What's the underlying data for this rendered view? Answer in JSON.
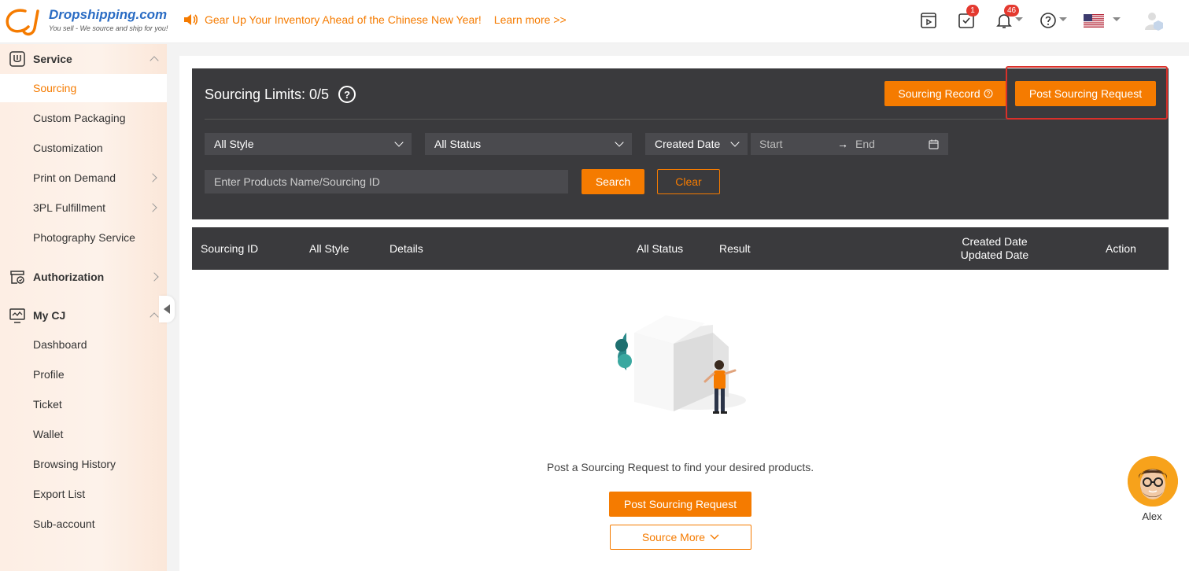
{
  "header": {
    "logo_name": "Dropshipping.com",
    "logo_tagline": "You sell - We source and ship for you!",
    "promo_text": "Gear Up Your Inventory Ahead of the Chinese New Year!",
    "promo_link": "Learn more >>",
    "tasks_badge": "1",
    "notifications_badge": "46",
    "help_icon": "help-circle-icon",
    "language_icon": "us-flag-icon"
  },
  "sidebar": {
    "service": {
      "label": "Service",
      "items": [
        "Sourcing",
        "Custom Packaging",
        "Customization",
        "Print on Demand",
        "3PL Fulfillment",
        "Photography Service"
      ]
    },
    "authorization": {
      "label": "Authorization"
    },
    "mycj": {
      "label": "My CJ",
      "items": [
        "Dashboard",
        "Profile",
        "Ticket",
        "Wallet",
        "Browsing History",
        "Export List",
        "Sub-account"
      ]
    }
  },
  "filter": {
    "limits": "Sourcing Limits: 0/5",
    "sourcing_record": "Sourcing Record",
    "post_request": "Post Sourcing Request",
    "style_select": "All Style",
    "status_select": "All Status",
    "date_select": "Created Date",
    "start_placeholder": "Start",
    "end_placeholder": "End",
    "search_placeholder": "Enter Products Name/Sourcing ID",
    "search_button": "Search",
    "clear_button": "Clear"
  },
  "table": {
    "columns": [
      "Sourcing ID",
      "All Style",
      "Details",
      "All Status",
      "Result",
      "Action"
    ],
    "date_col_line1": "Created Date",
    "date_col_line2": "Updated Date"
  },
  "empty": {
    "message": "Post a Sourcing Request to find your desired products.",
    "post_button": "Post Sourcing Request",
    "source_more": "Source More"
  },
  "chat": {
    "agent_name": "Alex"
  },
  "colors": {
    "accent": "#f57b00",
    "dark_panel": "#3a3a3d",
    "highlight": "#d9302a"
  }
}
